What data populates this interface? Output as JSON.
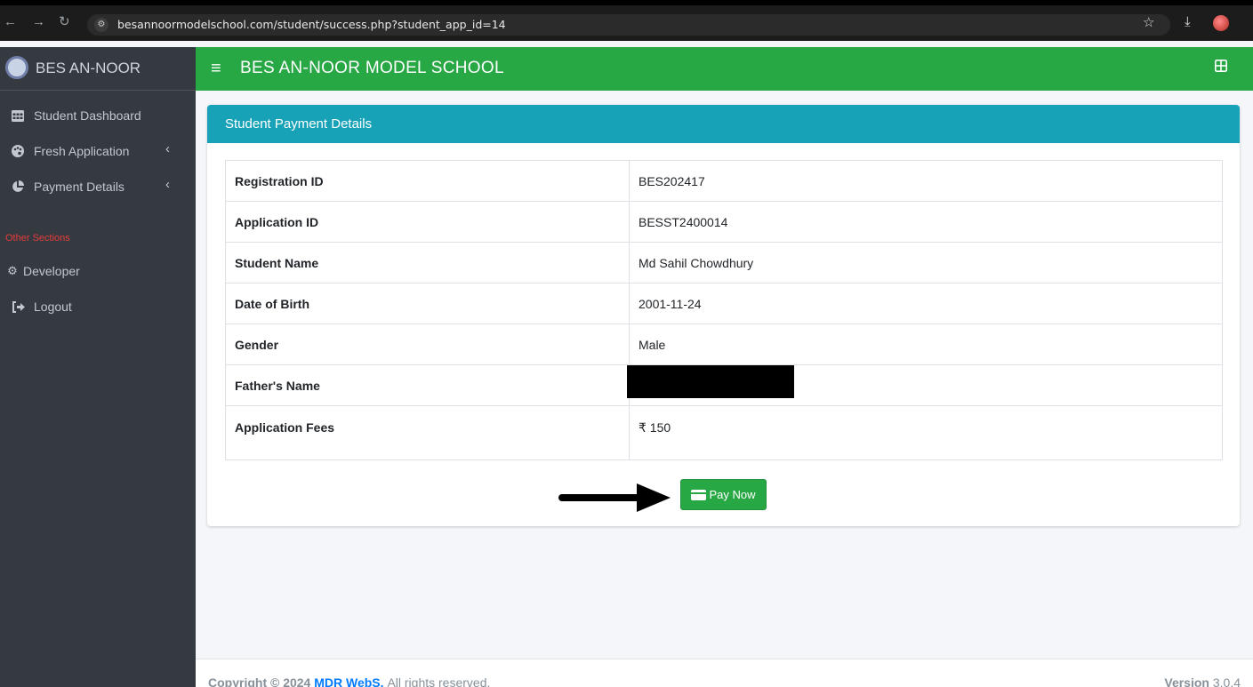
{
  "browser": {
    "url": "besannoormodelschool.com/student/success.php?student_app_id=14"
  },
  "sidebar": {
    "brand": "BES AN-NOOR",
    "items": [
      {
        "label": "Student Dashboard",
        "icon": "table-icon"
      },
      {
        "label": "Fresh Application",
        "icon": "palette-icon"
      },
      {
        "label": "Payment Details",
        "icon": "pie-chart-icon"
      }
    ],
    "section_header": "Other Sections",
    "other_items": [
      {
        "label": "Developer",
        "icon": "gear-icon"
      },
      {
        "label": "Logout",
        "icon": "sign-out-icon"
      }
    ]
  },
  "navbar": {
    "title": "BES AN-NOOR MODEL SCHOOL"
  },
  "card": {
    "title": "Student Payment Details",
    "rows": [
      {
        "key": "Registration ID",
        "value": "BES202417"
      },
      {
        "key": "Application ID",
        "value": "BESST2400014"
      },
      {
        "key": "Student Name",
        "value": "Md Sahil Chowdhury"
      },
      {
        "key": "Date of Birth",
        "value": "2001-11-24"
      },
      {
        "key": "Gender",
        "value": "Male"
      },
      {
        "key": "Father's Name",
        "value": ""
      },
      {
        "key": "Application Fees",
        "value": "₹ 150"
      }
    ],
    "pay_button": "Pay Now"
  },
  "footer": {
    "copyright": "Copyright © 2024",
    "company": "MDR WebS.",
    "rights": "All rights reserved.",
    "version_label": "Version",
    "version": "3.0.4"
  },
  "colors": {
    "navbar": "#28a745",
    "card_header": "#17a2b8",
    "sidebar": "#343a40",
    "button": "#28a745"
  }
}
